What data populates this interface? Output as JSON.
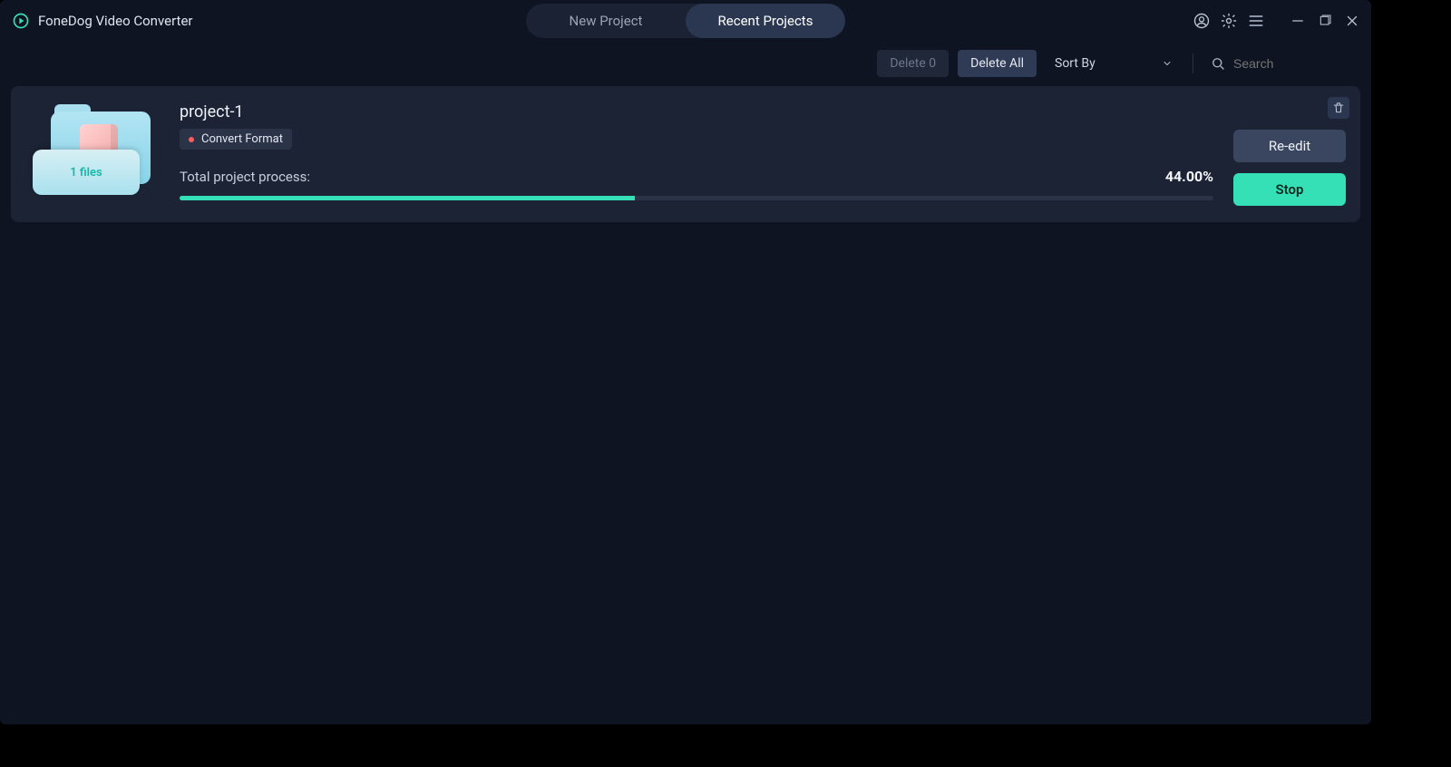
{
  "titlebar": {
    "app_name": "FoneDog Video Converter",
    "tabs": [
      {
        "label": "New Project",
        "active": false
      },
      {
        "label": "Recent Projects",
        "active": true
      }
    ]
  },
  "toolbar": {
    "delete_count_label": "Delete 0",
    "delete_all_label": "Delete All",
    "sort_by_label": "Sort By",
    "search_placeholder": "Search"
  },
  "project": {
    "thumb_badge": "1 files",
    "title": "project-1",
    "chip_label": "Convert Format",
    "process_label": "Total project process:",
    "percent_text": "44.00%",
    "percent_value": 44,
    "reedit_label": "Re-edit",
    "stop_label": "Stop"
  }
}
